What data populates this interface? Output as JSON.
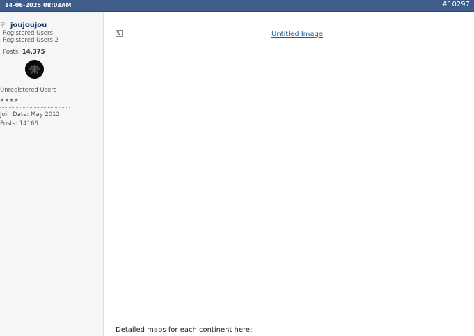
{
  "post_header": {
    "date": "14-06-2025 08:03AM",
    "post_number": "#10297"
  },
  "user": {
    "username": "joujoujou",
    "user_title": "Registered Users, Registered Users 2",
    "posts_label": "Posts:",
    "posts_count": "14,375",
    "group": "Unregistered Users",
    "stars": "★★★★",
    "join_date": "Join Date: May 2012",
    "posts_line": "Posts: 14166"
  },
  "post": {
    "image_alt": "Untitled Image",
    "detail_text": "Detailed maps for each continent here:"
  },
  "colors": {
    "header_bar": "#3e5d8b",
    "sidebar_bg": "#f5f6f8",
    "link": "#1a5d99",
    "username": "#1b3a66"
  },
  "icons": {
    "status": "offline-status-icon",
    "broken_image": "broken-image-icon"
  }
}
